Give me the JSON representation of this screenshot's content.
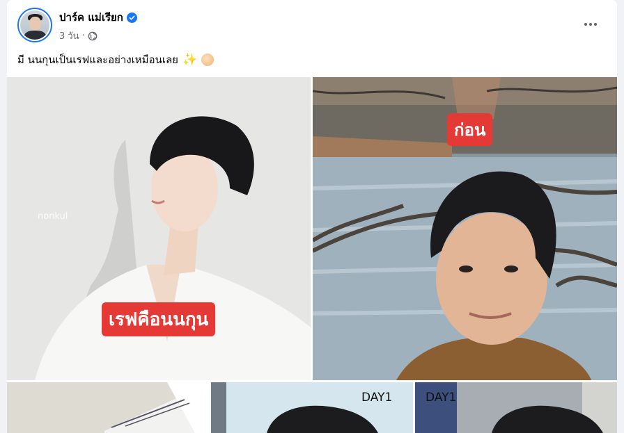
{
  "post": {
    "author": "ปาร์ค แม่เรียก",
    "time": "3 วัน",
    "separator": "·",
    "caption": "มี นนกุนเป็นเรฟและอย่างเหมือนเลย",
    "caption_emoji": "✨"
  },
  "photos": {
    "left_label": "เรฟคือนนกุน",
    "left_watermark": "nonkul",
    "right_label": "ก่อน",
    "day_left": "DAY1",
    "day_right": "DAY1"
  },
  "icons": {
    "verified": "verified-badge-icon",
    "privacy": "globe-icon",
    "more": "more-options-icon"
  },
  "colors": {
    "verified": "#1877f2",
    "label_red": "#e53935",
    "meta_gray": "#65676b"
  }
}
